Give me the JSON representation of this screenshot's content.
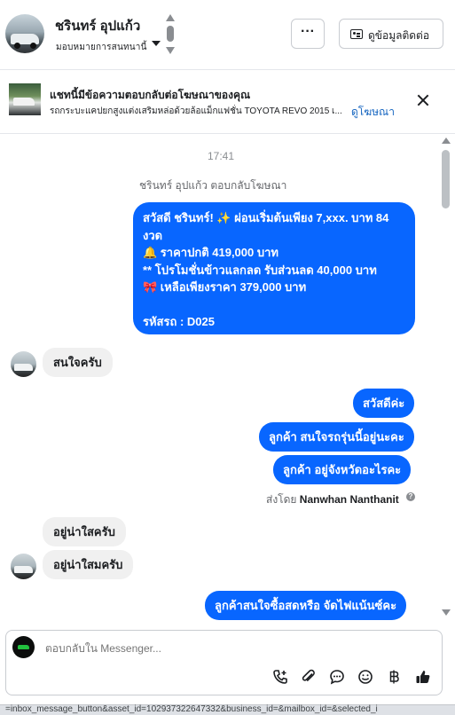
{
  "header": {
    "contact_name": "ชรินทร์ อุปแก้ว",
    "assigned_to": "มอบหมายการสนทนานี้",
    "more_label": "···",
    "contact_info_label": "ดูข้อมูลติดต่อ"
  },
  "ad_banner": {
    "title": "แชทนี้มีข้อความตอบกลับต่อโฆษณาของคุณ",
    "subtitle": "รถกระบะแคปยกสูงแต่งเสริมหล่อด้วยล้อแม็กแฟชั่น TOYOTA REVO 2015 เ...",
    "link_label": "ดูโฆษณา"
  },
  "chat": {
    "timestamp": "17:41",
    "reply_note": "ชรินทร์ อุปแก้ว ตอบกลับโฆษณา",
    "ad_reply_lines": [
      "สวัสดี ชรินทร์! ✨  ผ่อนเริ่มต้นเพียง 7,xxx. บาท 84",
      "งวด",
      "🔔 ราคาปกติ 419,000 บาท",
      "** โปรโมชั่นข้าวแลกลด รับส่วนลด 40,000 บาท",
      "🎀  เหลือเพียงราคา 379,000 บาท",
      "",
      "รหัสรถ : D025"
    ],
    "msg_in_1": "สนใจครับ",
    "msg_out_1": "สวัสดีค่ะ",
    "msg_out_2": "ลูกค้า สนใจรถรุ่นนี้อยู่นะคะ",
    "msg_out_3": "ลูกค้า อยู่จังหวัดอะไรคะ",
    "sent_by_prefix": "ส่งโดย",
    "sent_by_name": "Nanwhan Nanthanit",
    "msg_in_2": "อยู่น่าใสครับ",
    "msg_in_3": "อยู่น่าใสมครับ",
    "msg_out_4": "ลูกค้าสนใจซื้อสดหรือ จัดไฟแน้นซ์คะ"
  },
  "composer": {
    "placeholder": "ตอบกลับใน Messenger..."
  },
  "status_bar": {
    "url_text": "=inbox_message_button&asset_id=102937322647332&business_id=&mailbox_id=&selected_i"
  },
  "colors": {
    "accent": "#0866ff",
    "incoming_bubble": "#f0f0f0",
    "link": "#1565c0"
  },
  "icons": {
    "call": "phone-add-icon",
    "attach": "paperclip-icon",
    "saved_reply": "chat-bubble-icon",
    "emoji": "smiley-icon",
    "payment": "baht-icon",
    "like": "thumbs-up-icon"
  }
}
